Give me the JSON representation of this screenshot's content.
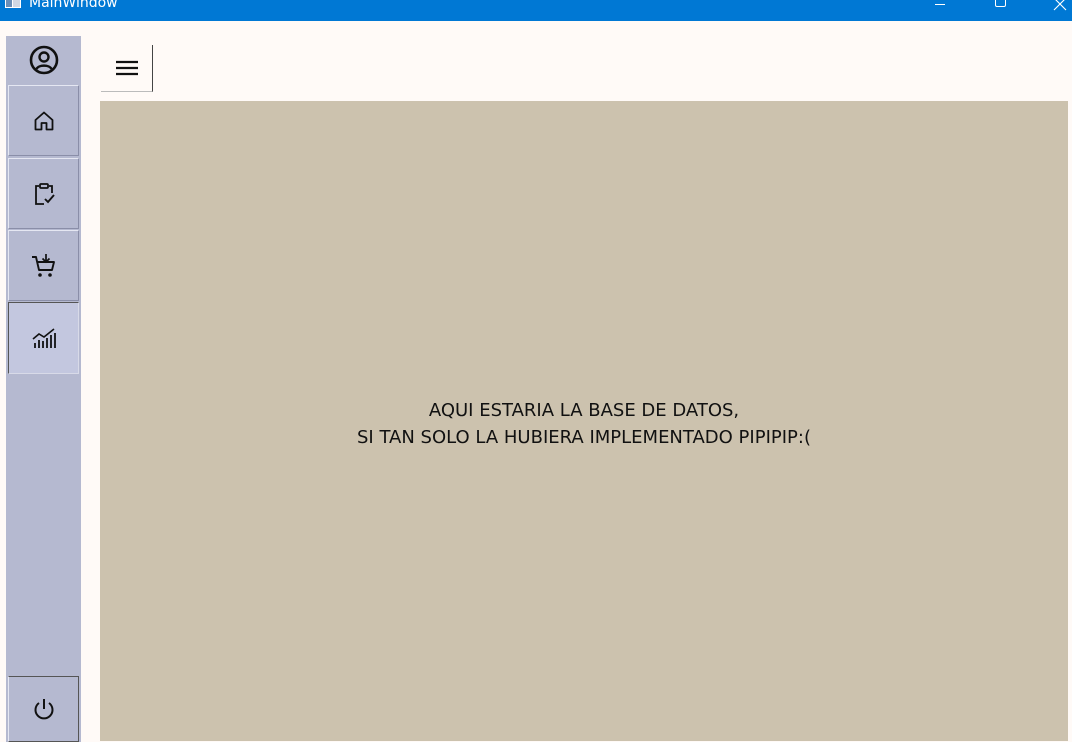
{
  "window": {
    "title": "MainWindow",
    "accent_color": "#0078d4",
    "controls": [
      "minimize-icon",
      "maximize-icon",
      "close-icon"
    ]
  },
  "sidebar": {
    "background": "#b5b9d0",
    "items": [
      {
        "id": "user",
        "icon": "user-circle-icon"
      },
      {
        "id": "home",
        "icon": "home-icon"
      },
      {
        "id": "orders",
        "icon": "clipboard-check-icon"
      },
      {
        "id": "cart",
        "icon": "cart-add-icon"
      },
      {
        "id": "stats",
        "icon": "chart-trend-icon",
        "selected": true
      },
      {
        "id": "power",
        "icon": "power-icon"
      }
    ]
  },
  "toolbar": {
    "menu_icon": "hamburger-icon"
  },
  "content": {
    "background": "#ccc2ae",
    "message_line1": "AQUI ESTARIA LA BASE DE DATOS,",
    "message_line2": "SI TAN SOLO LA HUBIERA IMPLEMENTADO PIPIPIP:("
  }
}
